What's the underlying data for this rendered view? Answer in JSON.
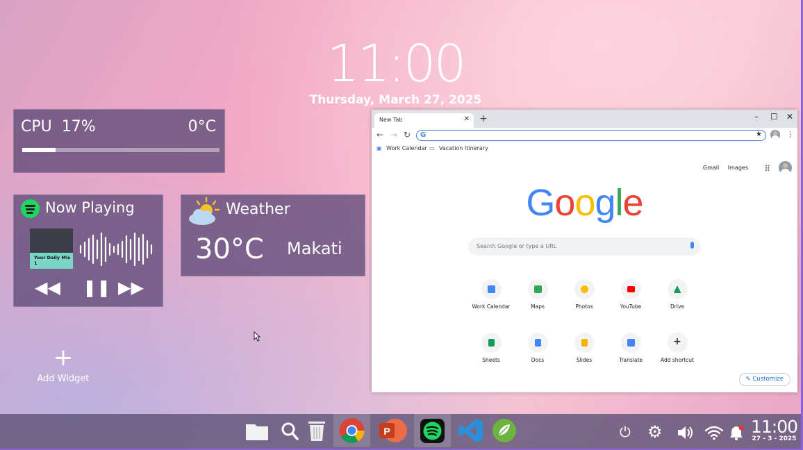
{
  "desktop": {
    "time": "11:00",
    "date": "Thursday, March 27, 2025"
  },
  "cpu_widget": {
    "label": "CPU",
    "percent_text": "17%",
    "usage_percent": 17,
    "temp": "0°C"
  },
  "now_playing": {
    "title": "Now Playing",
    "album_text": "Your Daily Mix 1",
    "icon": "spotify-icon"
  },
  "weather": {
    "title": "Weather",
    "temp": "30°C",
    "city": "Makati",
    "icon": "partly-cloudy-icon"
  },
  "add_widget": {
    "label": "Add Widget"
  },
  "chrome": {
    "tab_title": "New Tab",
    "bookmarks": [
      "Work Calendar",
      "Vacation Itinerary"
    ],
    "top_links": [
      "Gmail",
      "Images"
    ],
    "search_placeholder": "Search Google or type a URL",
    "logo": "Google",
    "shortcuts_row1": [
      {
        "label": "Work Calendar",
        "color": "#4285f4"
      },
      {
        "label": "Maps",
        "color": "#34a853"
      },
      {
        "label": "Photos",
        "color": "#fbbc04"
      },
      {
        "label": "YouTube",
        "color": "#ff0000"
      },
      {
        "label": "Drive",
        "color": "#0f9d58"
      }
    ],
    "shortcuts_row2": [
      {
        "label": "Sheets",
        "color": "#0f9d58"
      },
      {
        "label": "Docs",
        "color": "#4285f4"
      },
      {
        "label": "Slides",
        "color": "#f4b400"
      },
      {
        "label": "Translate",
        "color": "#4285f4"
      },
      {
        "label": "Add shortcut",
        "color": "#333333"
      }
    ],
    "customize_label": "Customize"
  },
  "taskbar": {
    "apps": [
      "files-icon",
      "search-icon",
      "trash-icon",
      "chrome-icon",
      "powerpoint-icon",
      "spotify-icon",
      "vscode-icon",
      "spring-icon"
    ],
    "tray": [
      "power-icon",
      "settings-icon",
      "volume-icon",
      "wifi-icon",
      "notification-icon"
    ],
    "time": "11:00",
    "date": "27 - 3 - 2025"
  }
}
